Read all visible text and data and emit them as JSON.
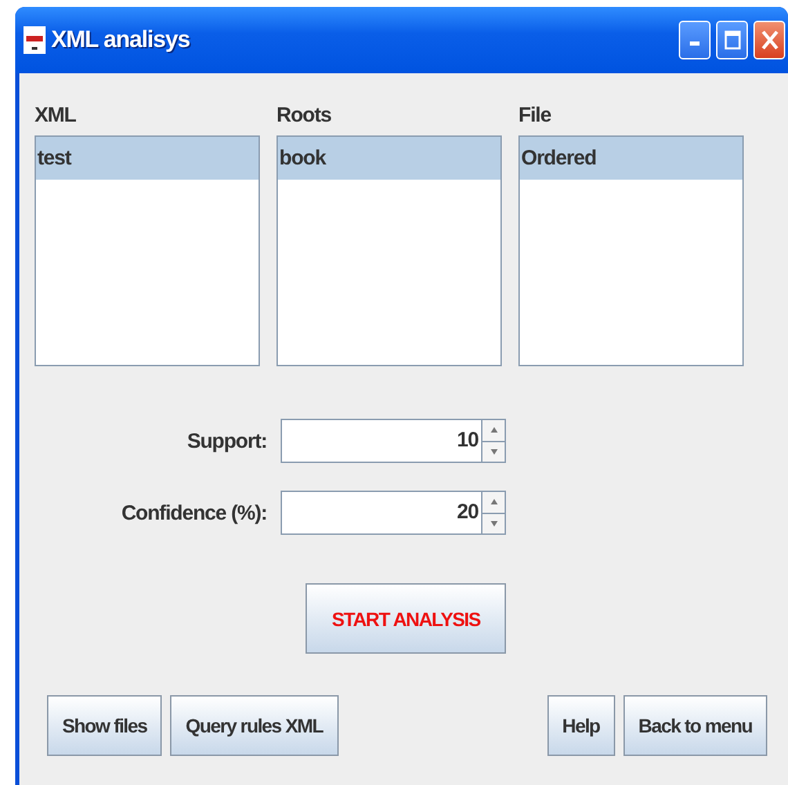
{
  "window": {
    "title": "XML analisys"
  },
  "lists": [
    {
      "label": "XML",
      "items": [
        {
          "text": "test",
          "selected": true
        }
      ]
    },
    {
      "label": "Roots",
      "items": [
        {
          "text": "book",
          "selected": true
        }
      ]
    },
    {
      "label": "File",
      "items": [
        {
          "text": "Ordered",
          "selected": true
        }
      ]
    }
  ],
  "spinners": [
    {
      "label": "Support:",
      "value": "10"
    },
    {
      "label": "Confidence (%):",
      "value": "20"
    }
  ],
  "start_button": "START ANALYSIS",
  "left_buttons": [
    "Show files",
    "Query rules XML"
  ],
  "right_buttons": [
    "Help",
    "Back to menu"
  ]
}
